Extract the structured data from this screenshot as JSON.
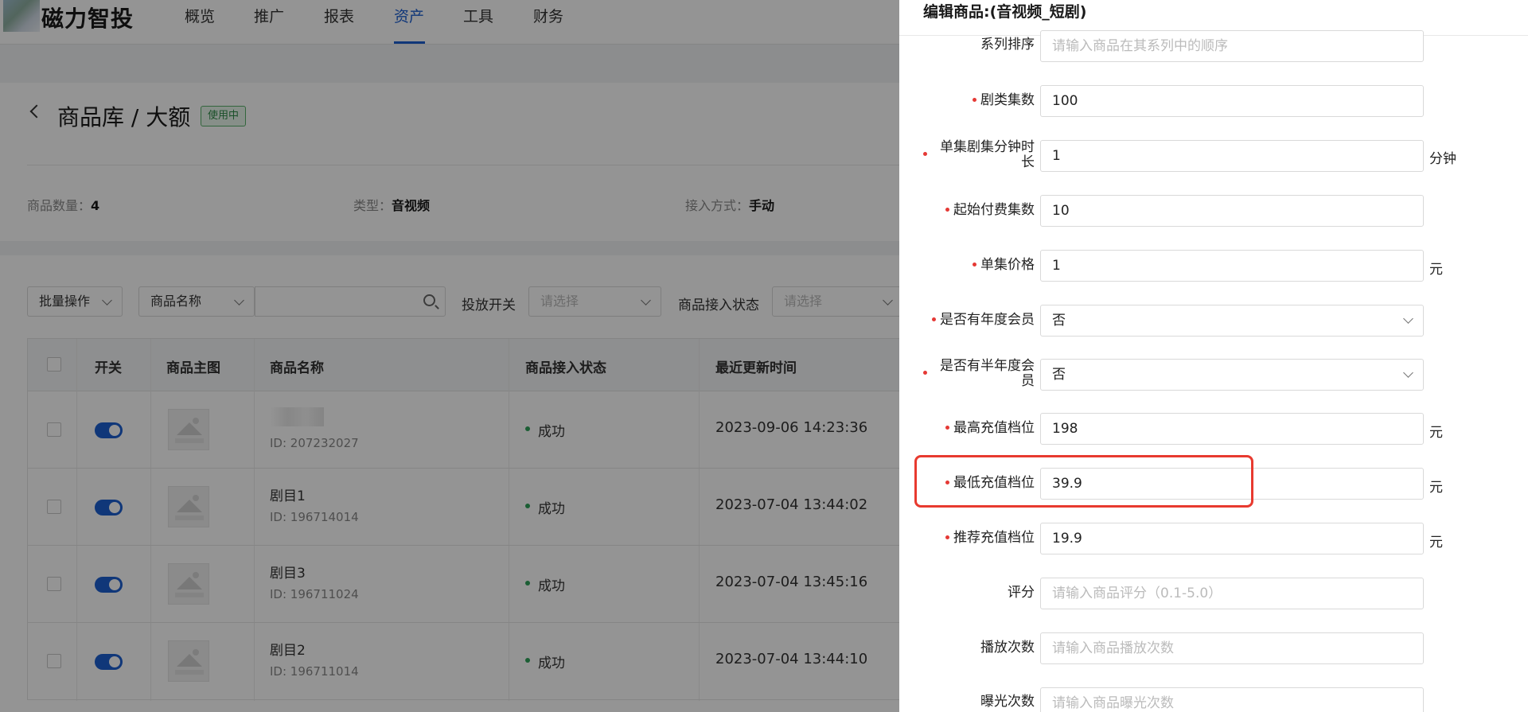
{
  "header": {
    "logo_text": "磁力智投",
    "nav": [
      "概览",
      "推广",
      "报表",
      "资产",
      "工具",
      "财务"
    ],
    "active_nav": "资产"
  },
  "page": {
    "title": "商品库 / 大额",
    "status_badge": "使用中",
    "meta": [
      {
        "label": "商品数量：",
        "value": "4"
      },
      {
        "label": "类型：",
        "value": "音视频"
      },
      {
        "label": "接入方式：",
        "value": "手动"
      }
    ]
  },
  "filters": {
    "batch_label": "批量操作",
    "name_select": "商品名称",
    "search_value": "",
    "delivery_label": "投放开关",
    "delivery_placeholder": "请选择",
    "access_label": "商品接入状态",
    "access_placeholder": "请选择"
  },
  "table": {
    "columns": [
      "开关",
      "商品主图",
      "商品名称",
      "商品接入状态",
      "最近更新时间"
    ],
    "rows": [
      {
        "name": "",
        "id": "ID: 207232027",
        "status": "成功",
        "updated": "2023-09-06 14:23:36"
      },
      {
        "name": "剧目1",
        "id": "ID: 196714014",
        "status": "成功",
        "updated": "2023-07-04 13:44:02"
      },
      {
        "name": "剧目3",
        "id": "ID: 196711024",
        "status": "成功",
        "updated": "2023-07-04 13:45:16"
      },
      {
        "name": "剧目2",
        "id": "ID: 196711014",
        "status": "成功",
        "updated": "2023-07-04 13:44:10"
      }
    ]
  },
  "drawer": {
    "title": "编辑商品:(音视频_短剧)",
    "fields": [
      {
        "label": "系列排序",
        "required": false,
        "value": "",
        "placeholder": "请输入商品在其系列中的顺序",
        "unit": ""
      },
      {
        "label": "剧类集数",
        "required": true,
        "value": "100",
        "placeholder": "",
        "unit": ""
      },
      {
        "label": "单集剧集分钟时长",
        "required": true,
        "value": "1",
        "placeholder": "",
        "unit": "分钟"
      },
      {
        "label": "起始付费集数",
        "required": true,
        "value": "10",
        "placeholder": "",
        "unit": ""
      },
      {
        "label": "单集价格",
        "required": true,
        "value": "1",
        "placeholder": "",
        "unit": "元"
      },
      {
        "label": "是否有年度会员",
        "required": true,
        "value": "否",
        "placeholder": "",
        "unit": "",
        "select": true
      },
      {
        "label": "是否有半年度会员",
        "required": true,
        "value": "否",
        "placeholder": "",
        "unit": "",
        "select": true
      },
      {
        "label": "最高充值档位",
        "required": true,
        "value": "198",
        "placeholder": "",
        "unit": "元"
      },
      {
        "label": "最低充值档位",
        "required": true,
        "value": "39.9",
        "placeholder": "",
        "unit": "元"
      },
      {
        "label": "推荐充值档位",
        "required": true,
        "value": "19.9",
        "placeholder": "",
        "unit": "元"
      },
      {
        "label": "评分",
        "required": false,
        "value": "",
        "placeholder": "请输入商品评分（0.1-5.0）",
        "unit": ""
      },
      {
        "label": "播放次数",
        "required": false,
        "value": "",
        "placeholder": "请输入商品播放次数",
        "unit": ""
      },
      {
        "label": "曝光次数",
        "required": false,
        "value": "",
        "placeholder": "请输入商品曝光次数",
        "unit": ""
      }
    ]
  },
  "colors": {
    "accent": "#1d5fd1",
    "success": "#2fa25a",
    "highlight": "#e83a2f",
    "required": "#e53935"
  }
}
